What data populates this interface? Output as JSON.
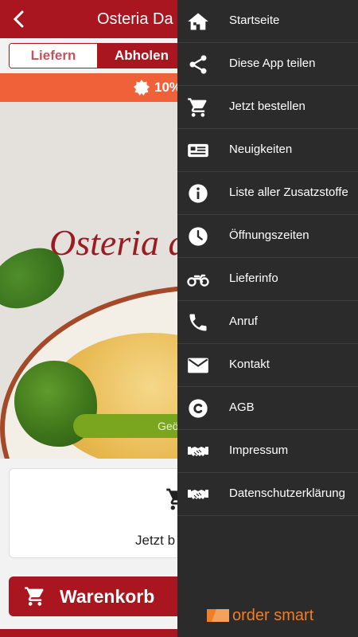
{
  "app": {
    "title": "Osteria Da Gi",
    "tabs": [
      "Liefern",
      "Abholen"
    ],
    "promo_text": "10%",
    "hero_logo_text": "Osteria d",
    "hero_button": "Geö",
    "card_text": "Jetzt b",
    "cart_button": "Warenkorb"
  },
  "drawer": {
    "items": [
      {
        "label": "Startseite",
        "icon": "home-icon"
      },
      {
        "label": "Diese App teilen",
        "icon": "share-icon"
      },
      {
        "label": "Jetzt bestellen",
        "icon": "cart-icon"
      },
      {
        "label": "Neuigkeiten",
        "icon": "news-icon"
      },
      {
        "label": "Liste aller Zusatzstoffe",
        "icon": "info-icon"
      },
      {
        "label": "Öffnungszeiten",
        "icon": "clock-icon"
      },
      {
        "label": "Lieferinfo",
        "icon": "motorbike-icon"
      },
      {
        "label": "Anruf",
        "icon": "phone-icon"
      },
      {
        "label": "Kontakt",
        "icon": "mail-icon"
      },
      {
        "label": "AGB",
        "icon": "copyright-icon"
      },
      {
        "label": "Impressum",
        "icon": "handshake-icon"
      },
      {
        "label": "Datenschutzerklärung",
        "icon": "handshake-icon"
      }
    ],
    "brand": "order smart"
  },
  "colors": {
    "primary": "#a9161f",
    "promo": "#f0613a",
    "drawer_bg": "#2b2b2b",
    "brand": "#f07d28"
  }
}
